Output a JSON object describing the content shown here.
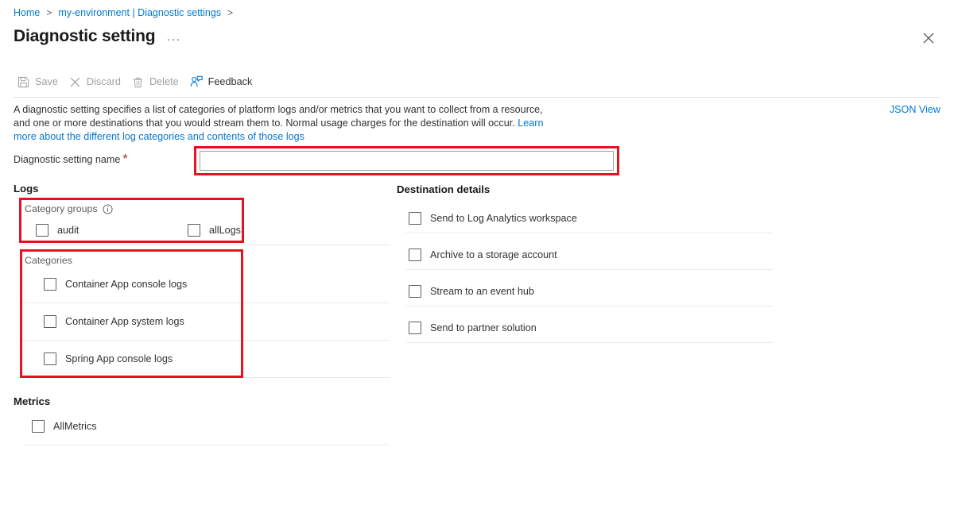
{
  "breadcrumb": {
    "items": [
      {
        "label": "Home",
        "icon": "none"
      },
      {
        "label": "my-environment | Diagnostic settings",
        "icon": "none"
      }
    ],
    "separator": ">"
  },
  "header": {
    "title": "Diagnostic setting",
    "more_label": "···",
    "close_icon": "close-icon"
  },
  "toolbar": {
    "items": [
      {
        "label": "Save",
        "icon": "save-icon",
        "enabled": false
      },
      {
        "label": "Discard",
        "icon": "discard-icon",
        "enabled": false
      },
      {
        "label": "Delete",
        "icon": "delete-icon",
        "enabled": false
      },
      {
        "label": "Feedback",
        "icon": "feedback-icon",
        "enabled": true
      }
    ]
  },
  "description": {
    "text_part_1": "A diagnostic setting specifies a list of categories of platform logs and/or metrics that you want to collect from a resource, and one or more destinations that you would stream them to. Normal usage charges for the destination will occur. ",
    "link_text": "Learn more about the different log categories and contents of those logs",
    "json_view_label": "JSON View"
  },
  "name_field": {
    "label": "Diagnostic setting name",
    "required_marker": "*",
    "value": "",
    "placeholder": ""
  },
  "logs": {
    "heading": "Logs",
    "category_groups": {
      "label": "Category groups",
      "info_icon": "info-icon",
      "items": [
        {
          "label": "audit",
          "checked": false
        },
        {
          "label": "allLogs",
          "checked": false
        }
      ]
    },
    "categories": {
      "label": "Categories",
      "items": [
        {
          "label": "Container App console logs",
          "checked": false
        },
        {
          "label": "Container App system logs",
          "checked": false
        },
        {
          "label": "Spring App console logs",
          "checked": false
        }
      ]
    }
  },
  "metrics": {
    "heading": "Metrics",
    "items": [
      {
        "label": "AllMetrics",
        "checked": false
      }
    ]
  },
  "destination": {
    "heading": "Destination details",
    "items": [
      {
        "label": "Send to Log Analytics workspace",
        "checked": false
      },
      {
        "label": "Archive to a storage account",
        "checked": false
      },
      {
        "label": "Stream to an event hub",
        "checked": false
      },
      {
        "label": "Send to partner solution",
        "checked": false
      }
    ]
  },
  "annotations": {
    "color": "#e81123",
    "boxes": [
      "name-input",
      "category-groups",
      "categories"
    ]
  },
  "colors": {
    "link": "#0078d4",
    "required": "#a4262c",
    "annotation": "#e81123",
    "text": "#323130",
    "muted": "#605e5c",
    "divider": "#edebe9"
  }
}
